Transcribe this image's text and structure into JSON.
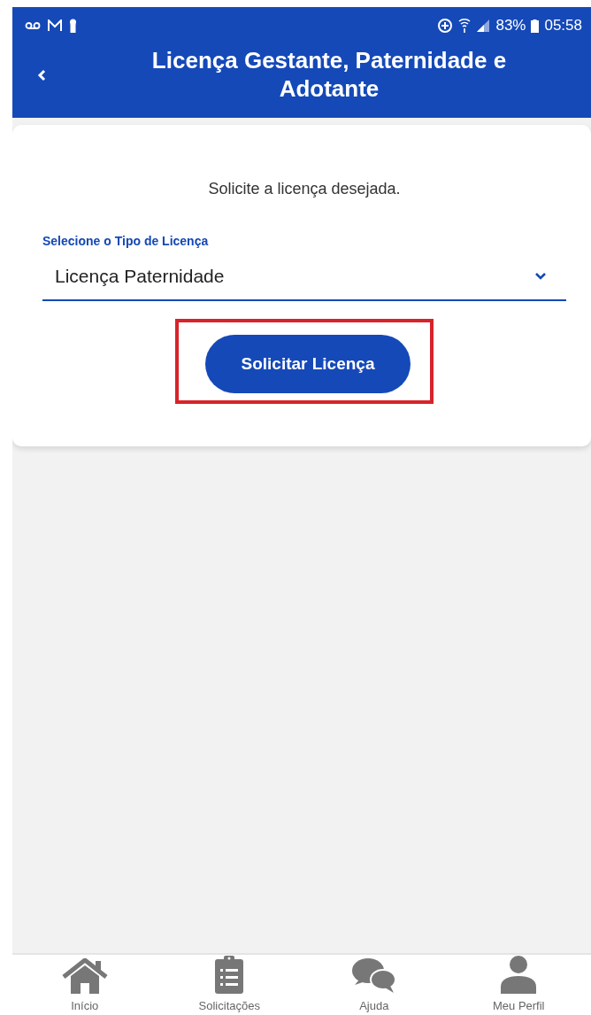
{
  "status_bar": {
    "battery": "83%",
    "time": "05:58"
  },
  "header": {
    "title": "Licença Gestante, Paternidade e Adotante"
  },
  "card": {
    "intro": "Solicite a licença desejada.",
    "select": {
      "label": "Selecione o Tipo de Licença",
      "value": "Licença Paternidade"
    },
    "button": {
      "label": "Solicitar Licença",
      "highlighted": true
    }
  },
  "bottom_nav": [
    {
      "label": "Início",
      "kind": "home",
      "selected": false
    },
    {
      "label": "Solicitações",
      "kind": "clipboard",
      "selected": false
    },
    {
      "label": "Ajuda",
      "kind": "chat",
      "selected": false
    },
    {
      "label": "Meu Perfil",
      "kind": "person",
      "selected": false
    }
  ]
}
